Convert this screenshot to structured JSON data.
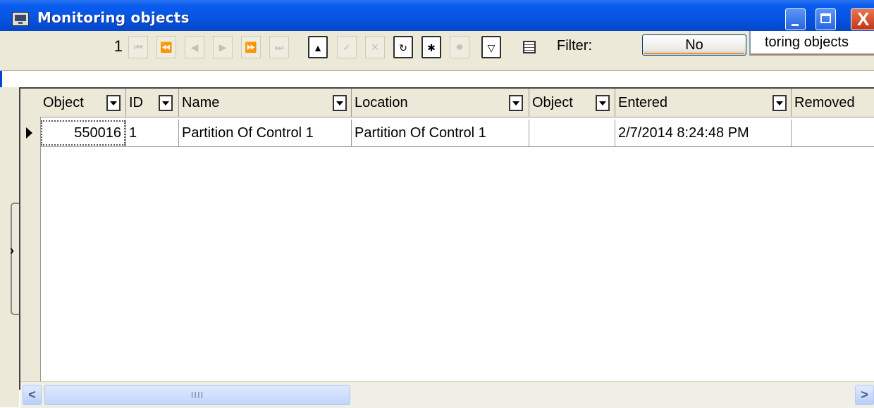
{
  "window": {
    "title": "Monitoring objects",
    "close_glyph": "X",
    "colors": {
      "titlebar": "#0653e2",
      "toolbar": "#ece9d8",
      "close": "#c2351a"
    }
  },
  "toolbar": {
    "record_number": "1",
    "filter_label": "Filter:",
    "filter_button": "No",
    "monitoring_field_value": "toring objects"
  },
  "navigator": [
    {
      "name": "first-record-icon",
      "glyph": "⏮",
      "enabled": false
    },
    {
      "name": "prior-page-icon",
      "glyph": "⏪",
      "enabled": false
    },
    {
      "name": "prior-record-icon",
      "glyph": "◀",
      "enabled": false
    },
    {
      "name": "next-record-icon",
      "glyph": "▶",
      "enabled": false
    },
    {
      "name": "next-page-icon",
      "glyph": "⏩",
      "enabled": false
    },
    {
      "name": "last-record-icon",
      "glyph": "⏭",
      "enabled": false
    },
    {
      "name": "move-up-icon",
      "glyph": "▲",
      "enabled": true
    },
    {
      "name": "post-check-icon",
      "glyph": "✓",
      "enabled": false
    },
    {
      "name": "cancel-x-icon",
      "glyph": "✕",
      "enabled": false
    },
    {
      "name": "refresh-icon",
      "glyph": "↻",
      "enabled": true
    },
    {
      "name": "insert-asterisk-icon",
      "glyph": "✱",
      "enabled": true
    },
    {
      "name": "sparkle-icon",
      "glyph": "✸",
      "enabled": false
    },
    {
      "name": "funnel-filter-icon",
      "glyph": "▽",
      "enabled": true
    }
  ],
  "grid": {
    "columns": [
      {
        "label": "Object"
      },
      {
        "label": "ID"
      },
      {
        "label": "Name"
      },
      {
        "label": "Location"
      },
      {
        "label": "Object"
      },
      {
        "label": "Entered"
      },
      {
        "label": "Removed"
      }
    ],
    "rows": [
      [
        "550016",
        "1",
        "Partition Of Control 1",
        "Partition Of Control 1",
        "",
        "2/7/2014 8:24:48 PM",
        ""
      ]
    ]
  },
  "splitter": {
    "arrow": "›"
  },
  "scrollbar": {
    "left_arrow": "<",
    "right_arrow": ">",
    "thumb_grip": "IIII"
  }
}
